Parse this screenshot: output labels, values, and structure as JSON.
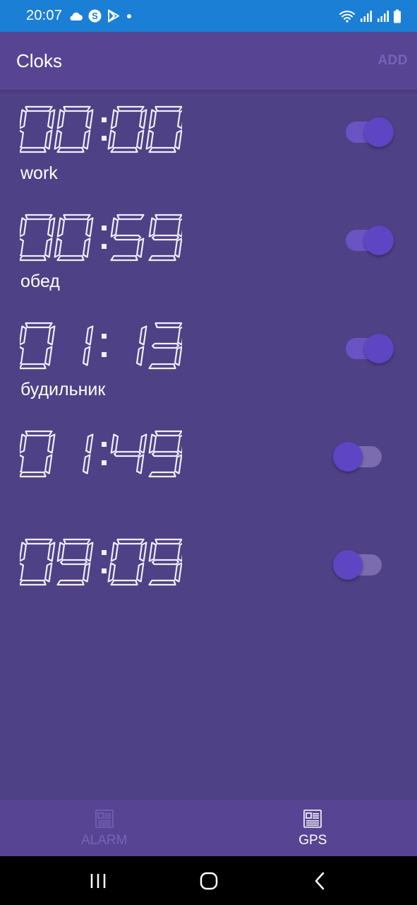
{
  "status_bar": {
    "time": "20:07",
    "left_icons": [
      "cloud-icon",
      "skype-icon",
      "play-store-icon",
      "dot-icon"
    ],
    "right_icons": [
      "wifi-icon",
      "signal-icon",
      "signal-icon",
      "battery-icon"
    ]
  },
  "app_bar": {
    "title": "Cloks",
    "add_label": "ADD"
  },
  "alarms": [
    {
      "time": "00:00",
      "label": "work",
      "enabled": true
    },
    {
      "time": "00:59",
      "label": "обед",
      "enabled": true
    },
    {
      "time": "01:13",
      "label": "будильник",
      "enabled": true
    },
    {
      "time": "01:49",
      "label": "",
      "enabled": false
    },
    {
      "time": "09:09",
      "label": "",
      "enabled": false
    }
  ],
  "bottom_nav": {
    "items": [
      {
        "label": "ALARM",
        "icon": "newspaper-icon",
        "selected": false
      },
      {
        "label": "GPS",
        "icon": "newspaper-icon",
        "selected": true
      }
    ]
  },
  "system_nav": [
    "recents-button",
    "home-button",
    "back-button"
  ],
  "colors": {
    "background": "#4f4186",
    "app_bar": "#574593",
    "status_bar": "#1b7fd6",
    "accent": "#5d45c3",
    "digit": "#f2eefc"
  }
}
